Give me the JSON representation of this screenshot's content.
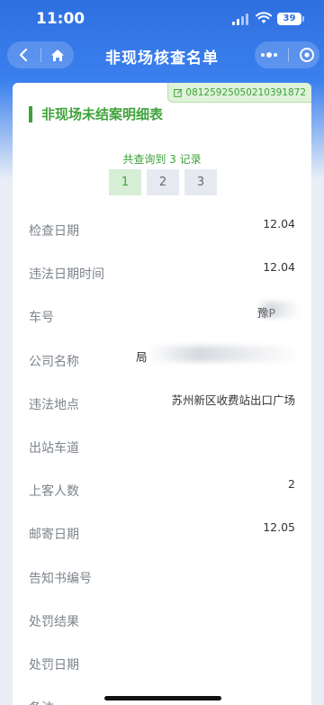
{
  "status_bar": {
    "time": "11:00",
    "battery": "39"
  },
  "nav": {
    "title": "非现场核查名单"
  },
  "card": {
    "case_number": "08125925050210391872",
    "section_title": "非现场未结案明细表",
    "record_count_text": "共查询到 3 记录",
    "pages": [
      "1",
      "2",
      "3"
    ],
    "active_page": "1"
  },
  "fields": [
    {
      "label": "检查日期",
      "value": "12.04"
    },
    {
      "label": "违法日期时间",
      "value": "12.04"
    },
    {
      "label": "车号",
      "value": "豫P"
    },
    {
      "label": "公司名称",
      "value": "局"
    },
    {
      "label": "违法地点",
      "value": "苏州新区收费站出口广场"
    },
    {
      "label": "出站车道",
      "value": ""
    },
    {
      "label": "上客人数",
      "value": "2"
    },
    {
      "label": "邮寄日期",
      "value": "12.05"
    },
    {
      "label": "告知书编号",
      "value": ""
    },
    {
      "label": "处罚结果",
      "value": ""
    },
    {
      "label": "处罚日期",
      "value": ""
    },
    {
      "label": "备注",
      "value": ""
    }
  ],
  "colors": {
    "accent_green": "#3ea23a",
    "nav_blue": "#2f6fe0"
  }
}
